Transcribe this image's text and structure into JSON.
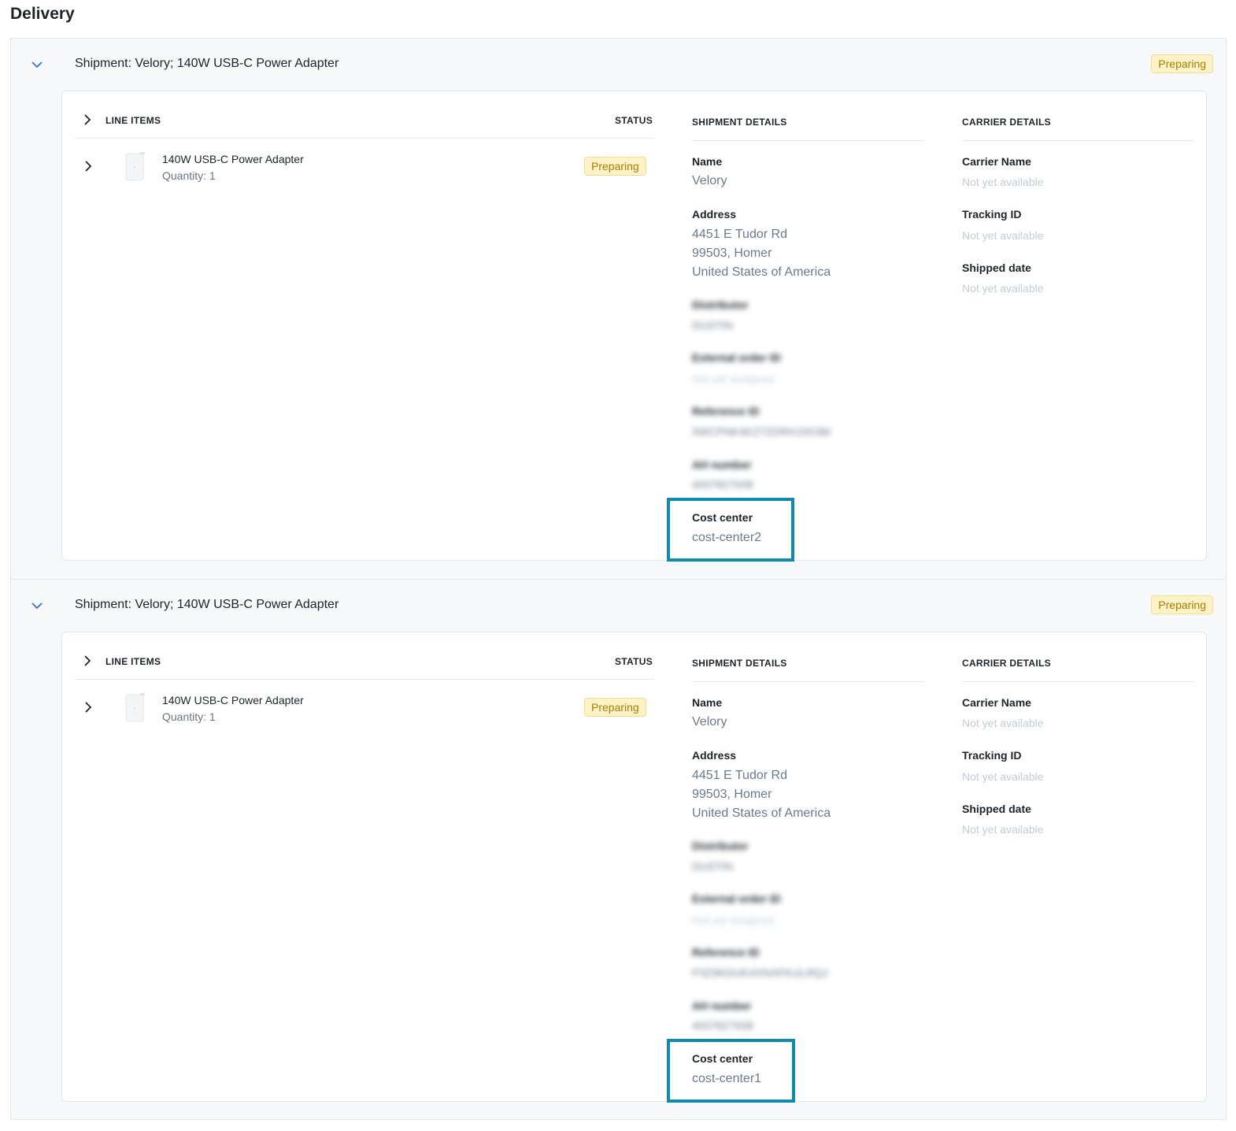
{
  "page": {
    "title": "Delivery"
  },
  "colors": {
    "accent_highlight": "#0f8bb0",
    "badge_bg": "#fdf3c6",
    "badge_text": "#a77d05"
  },
  "shipments": [
    {
      "title": "Shipment: Velory; 140W USB-C Power Adapter",
      "status": "Preparing",
      "line_items_header": "LINE ITEMS",
      "status_header": "STATUS",
      "items": [
        {
          "name": "140W USB-C Power Adapter",
          "quantity": "Quantity: 1",
          "status": "Preparing"
        }
      ],
      "shipment_details": {
        "header": "SHIPMENT DETAILS",
        "name_label": "Name",
        "name_value": "Velory",
        "address_label": "Address",
        "address_line1": "4451 E Tudor Rd",
        "address_line2": "99503, Homer",
        "address_line3": "United States of America",
        "distributor_label": "Distributor",
        "distributor_value": "DUSTIN",
        "external_order_label": "External order ID",
        "external_order_value": "Not yet assigned",
        "reference_label": "Reference ID",
        "reference_value": "5WCPNK4KZ7ZDRHJ3S3M",
        "ah_label": "AH number",
        "ah_value": "4007827938",
        "cost_center_label": "Cost center",
        "cost_center_value": "cost-center2"
      },
      "carrier_details": {
        "header": "CARRIER DETAILS",
        "carrier_name_label": "Carrier Name",
        "carrier_name_value": "Not yet available",
        "tracking_label": "Tracking ID",
        "tracking_value": "Not yet available",
        "shipped_label": "Shipped date",
        "shipped_value": "Not yet available"
      }
    },
    {
      "title": "Shipment: Velory; 140W USB-C Power Adapter",
      "status": "Preparing",
      "line_items_header": "LINE ITEMS",
      "status_header": "STATUS",
      "items": [
        {
          "name": "140W USB-C Power Adapter",
          "quantity": "Quantity: 1",
          "status": "Preparing"
        }
      ],
      "shipment_details": {
        "header": "SHIPMENT DETAILS",
        "name_label": "Name",
        "name_value": "Velory",
        "address_label": "Address",
        "address_line1": "4451 E Tudor Rd",
        "address_line2": "99503, Homer",
        "address_line3": "United States of America",
        "distributor_label": "Distributor",
        "distributor_value": "DUSTIN",
        "external_order_label": "External order ID",
        "external_order_value": "Not yet assigned",
        "reference_label": "Reference ID",
        "reference_value": "P3Z9KDUK4XNAFKULRQJ",
        "ah_label": "AH number",
        "ah_value": "4007827938",
        "cost_center_label": "Cost center",
        "cost_center_value": "cost-center1"
      },
      "carrier_details": {
        "header": "CARRIER DETAILS",
        "carrier_name_label": "Carrier Name",
        "carrier_name_value": "Not yet available",
        "tracking_label": "Tracking ID",
        "tracking_value": "Not yet available",
        "shipped_label": "Shipped date",
        "shipped_value": "Not yet available"
      }
    }
  ]
}
